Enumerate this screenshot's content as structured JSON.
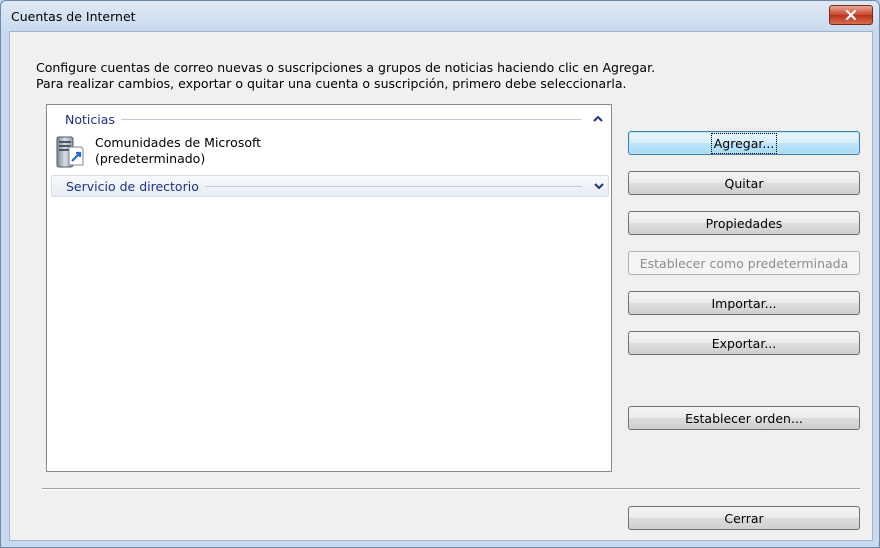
{
  "window": {
    "title": "Cuentas de Internet"
  },
  "description": {
    "line1": "Configure cuentas de correo nuevas o suscripciones a grupos de noticias haciendo clic en Agregar.",
    "line2": "Para realizar cambios, exportar o quitar una cuenta o suscripción, primero debe seleccionarla."
  },
  "list": {
    "groups": [
      {
        "title": "Noticias",
        "expanded": true,
        "items": [
          {
            "name": "Comunidades de Microsoft",
            "status": "(predeterminado)",
            "icon": "news-server-icon"
          }
        ]
      },
      {
        "title": "Servicio de directorio",
        "expanded": false,
        "items": []
      }
    ]
  },
  "buttons": {
    "add": "Agregar...",
    "remove": "Quitar",
    "properties": "Propiedades",
    "set_default": "Establecer como predeterminada",
    "import": "Importar...",
    "export": "Exportar...",
    "set_order": "Establecer orden...",
    "close": "Cerrar"
  },
  "colors": {
    "group_title": "#1e3287",
    "close_button": "#c9452d",
    "default_button_border": "#3c7fb1"
  }
}
